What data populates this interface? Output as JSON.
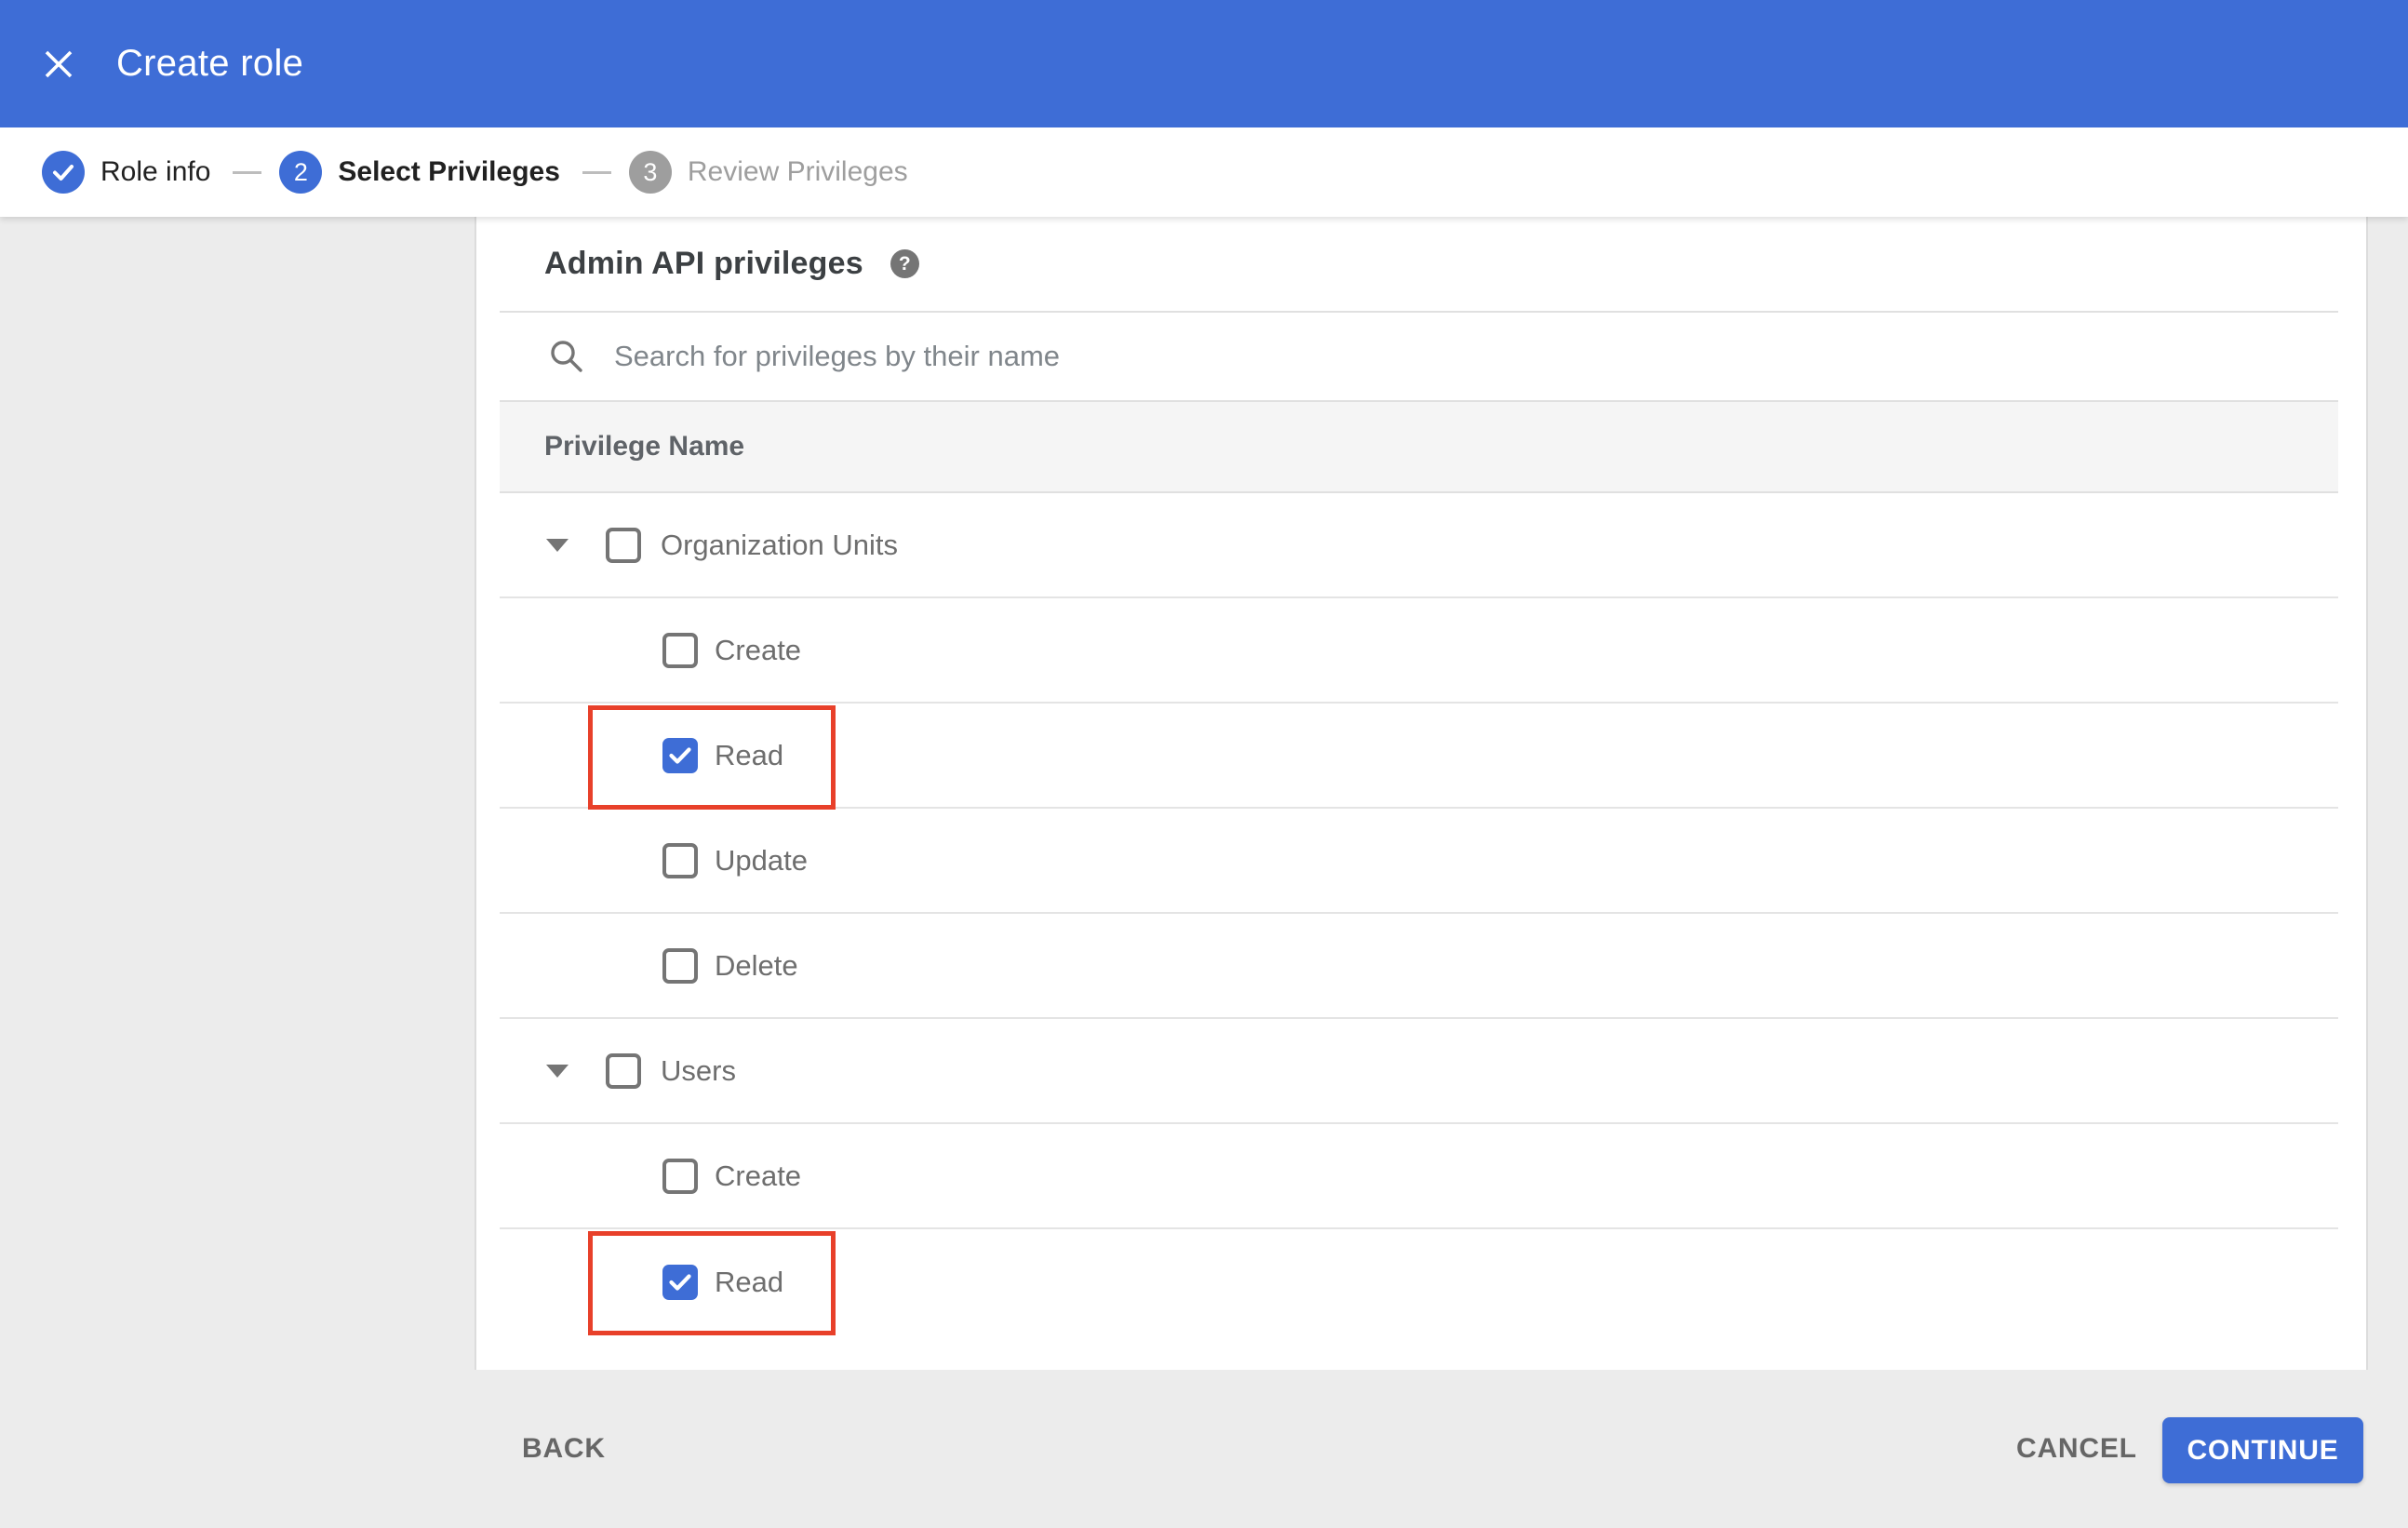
{
  "titlebar": {
    "title": "Create role"
  },
  "stepper": {
    "steps": [
      {
        "label": "Role info",
        "state": "completed",
        "glyph": "check"
      },
      {
        "label": "Select Privileges",
        "state": "active",
        "number": "2"
      },
      {
        "label": "Review Privileges",
        "state": "upcoming",
        "number": "3"
      }
    ]
  },
  "content": {
    "heading": "Admin API privileges",
    "help_glyph": "?",
    "search_placeholder": "Search for privileges by their name",
    "table_header": "Privilege Name",
    "rows": [
      {
        "label": "Organization Units",
        "type": "group",
        "expanded": true,
        "checked": false,
        "highlighted": false
      },
      {
        "label": "Create",
        "type": "child",
        "checked": false,
        "highlighted": false
      },
      {
        "label": "Read",
        "type": "child",
        "checked": true,
        "highlighted": true
      },
      {
        "label": "Update",
        "type": "child",
        "checked": false,
        "highlighted": false
      },
      {
        "label": "Delete",
        "type": "child",
        "checked": false,
        "highlighted": false
      },
      {
        "label": "Users",
        "type": "group",
        "expanded": true,
        "checked": false,
        "highlighted": false
      },
      {
        "label": "Create",
        "type": "child",
        "checked": false,
        "highlighted": false
      },
      {
        "label": "Read",
        "type": "child",
        "checked": true,
        "highlighted": true
      }
    ]
  },
  "footer": {
    "back_label": "BACK",
    "cancel_label": "CANCEL",
    "continue_label": "CONTINUE"
  },
  "icons": {
    "close": "close-icon",
    "check": "check-icon",
    "search": "search-icon",
    "help": "question-mark-icon",
    "expand": "chevron-down-triangle-icon"
  },
  "colors": {
    "primary_blue": "#3E6DD6",
    "highlight_red": "#E8402A",
    "page_gray": "#ECECEC",
    "table_header_bg": "#F5F5F5",
    "divider": "#E0E0E0",
    "muted_step": "#9E9E9E",
    "row_text": "#6E6E6E"
  }
}
